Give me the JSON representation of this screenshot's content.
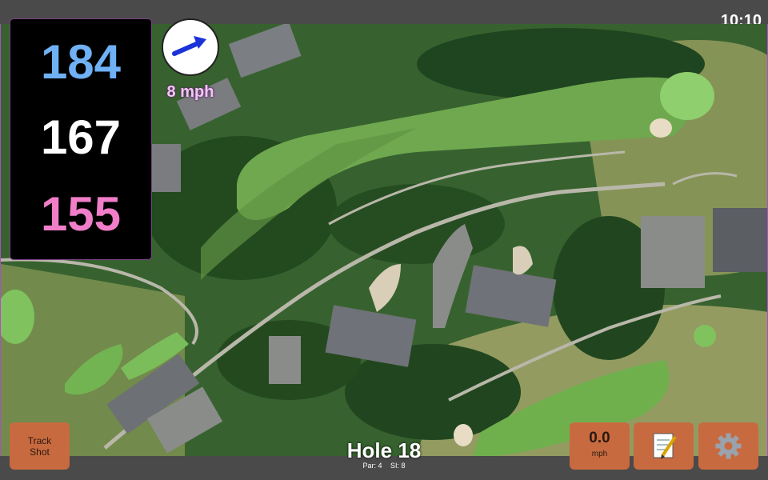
{
  "status": {
    "time": "10:10"
  },
  "distances": {
    "back": {
      "value": "184",
      "color": "#6fb1f4"
    },
    "middle": {
      "value": "167",
      "color": "#ffffff"
    },
    "front": {
      "value": "155",
      "color": "#f07ec8"
    }
  },
  "wind": {
    "speed_label": "8 mph",
    "arrow_color": "#1a32d8",
    "icon": "wind-arrow-icon"
  },
  "buttons": {
    "track_shot": {
      "line1": "Track",
      "line2": "Shot"
    },
    "speed": {
      "value": "0.0",
      "unit": "mph"
    },
    "notes": {
      "icon": "notepad-icon"
    },
    "settings": {
      "icon": "gear-icon"
    }
  },
  "hole": {
    "title": "Hole 18",
    "par": "Par: 4",
    "stroke_index": "SI: 8"
  },
  "colors": {
    "button": "#c86a3f",
    "panel_border": "#b04cc8",
    "fairway": "#6fa84f",
    "green": "#8fcf6e"
  }
}
